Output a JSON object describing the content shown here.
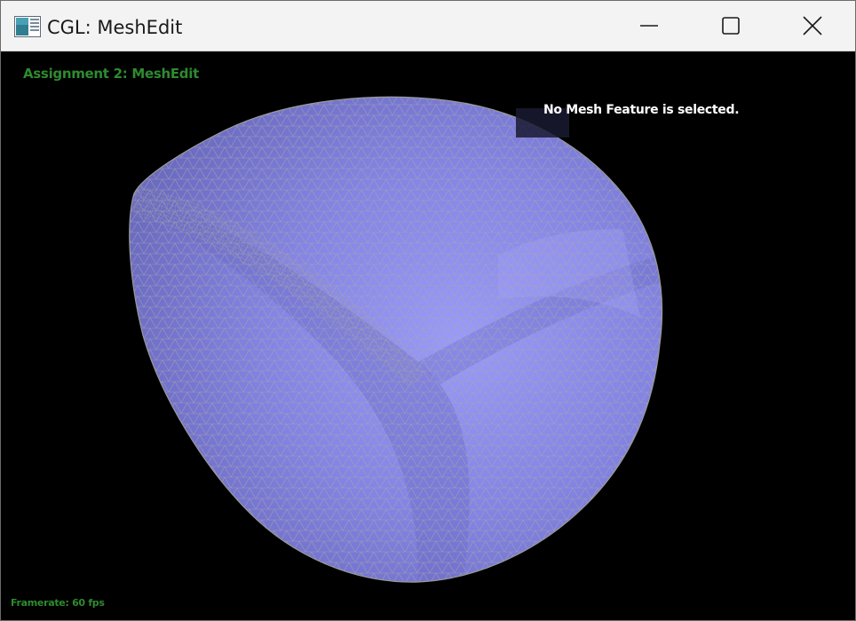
{
  "window": {
    "title": "CGL: MeshEdit",
    "controls": {
      "minimize_icon": "minimize-icon",
      "maximize_icon": "maximize-icon",
      "close_icon": "close-icon"
    }
  },
  "viewport": {
    "assignment_title": "Assignment 2: MeshEdit",
    "selection_status": "No Mesh Feature is selected.",
    "framerate": "Framerate: 60 fps"
  },
  "colors": {
    "overlay_text_green": "#2e8b2e",
    "mesh_fill": "#8a8ae6",
    "mesh_wire": "#9a9a9a",
    "background": "#000000"
  }
}
